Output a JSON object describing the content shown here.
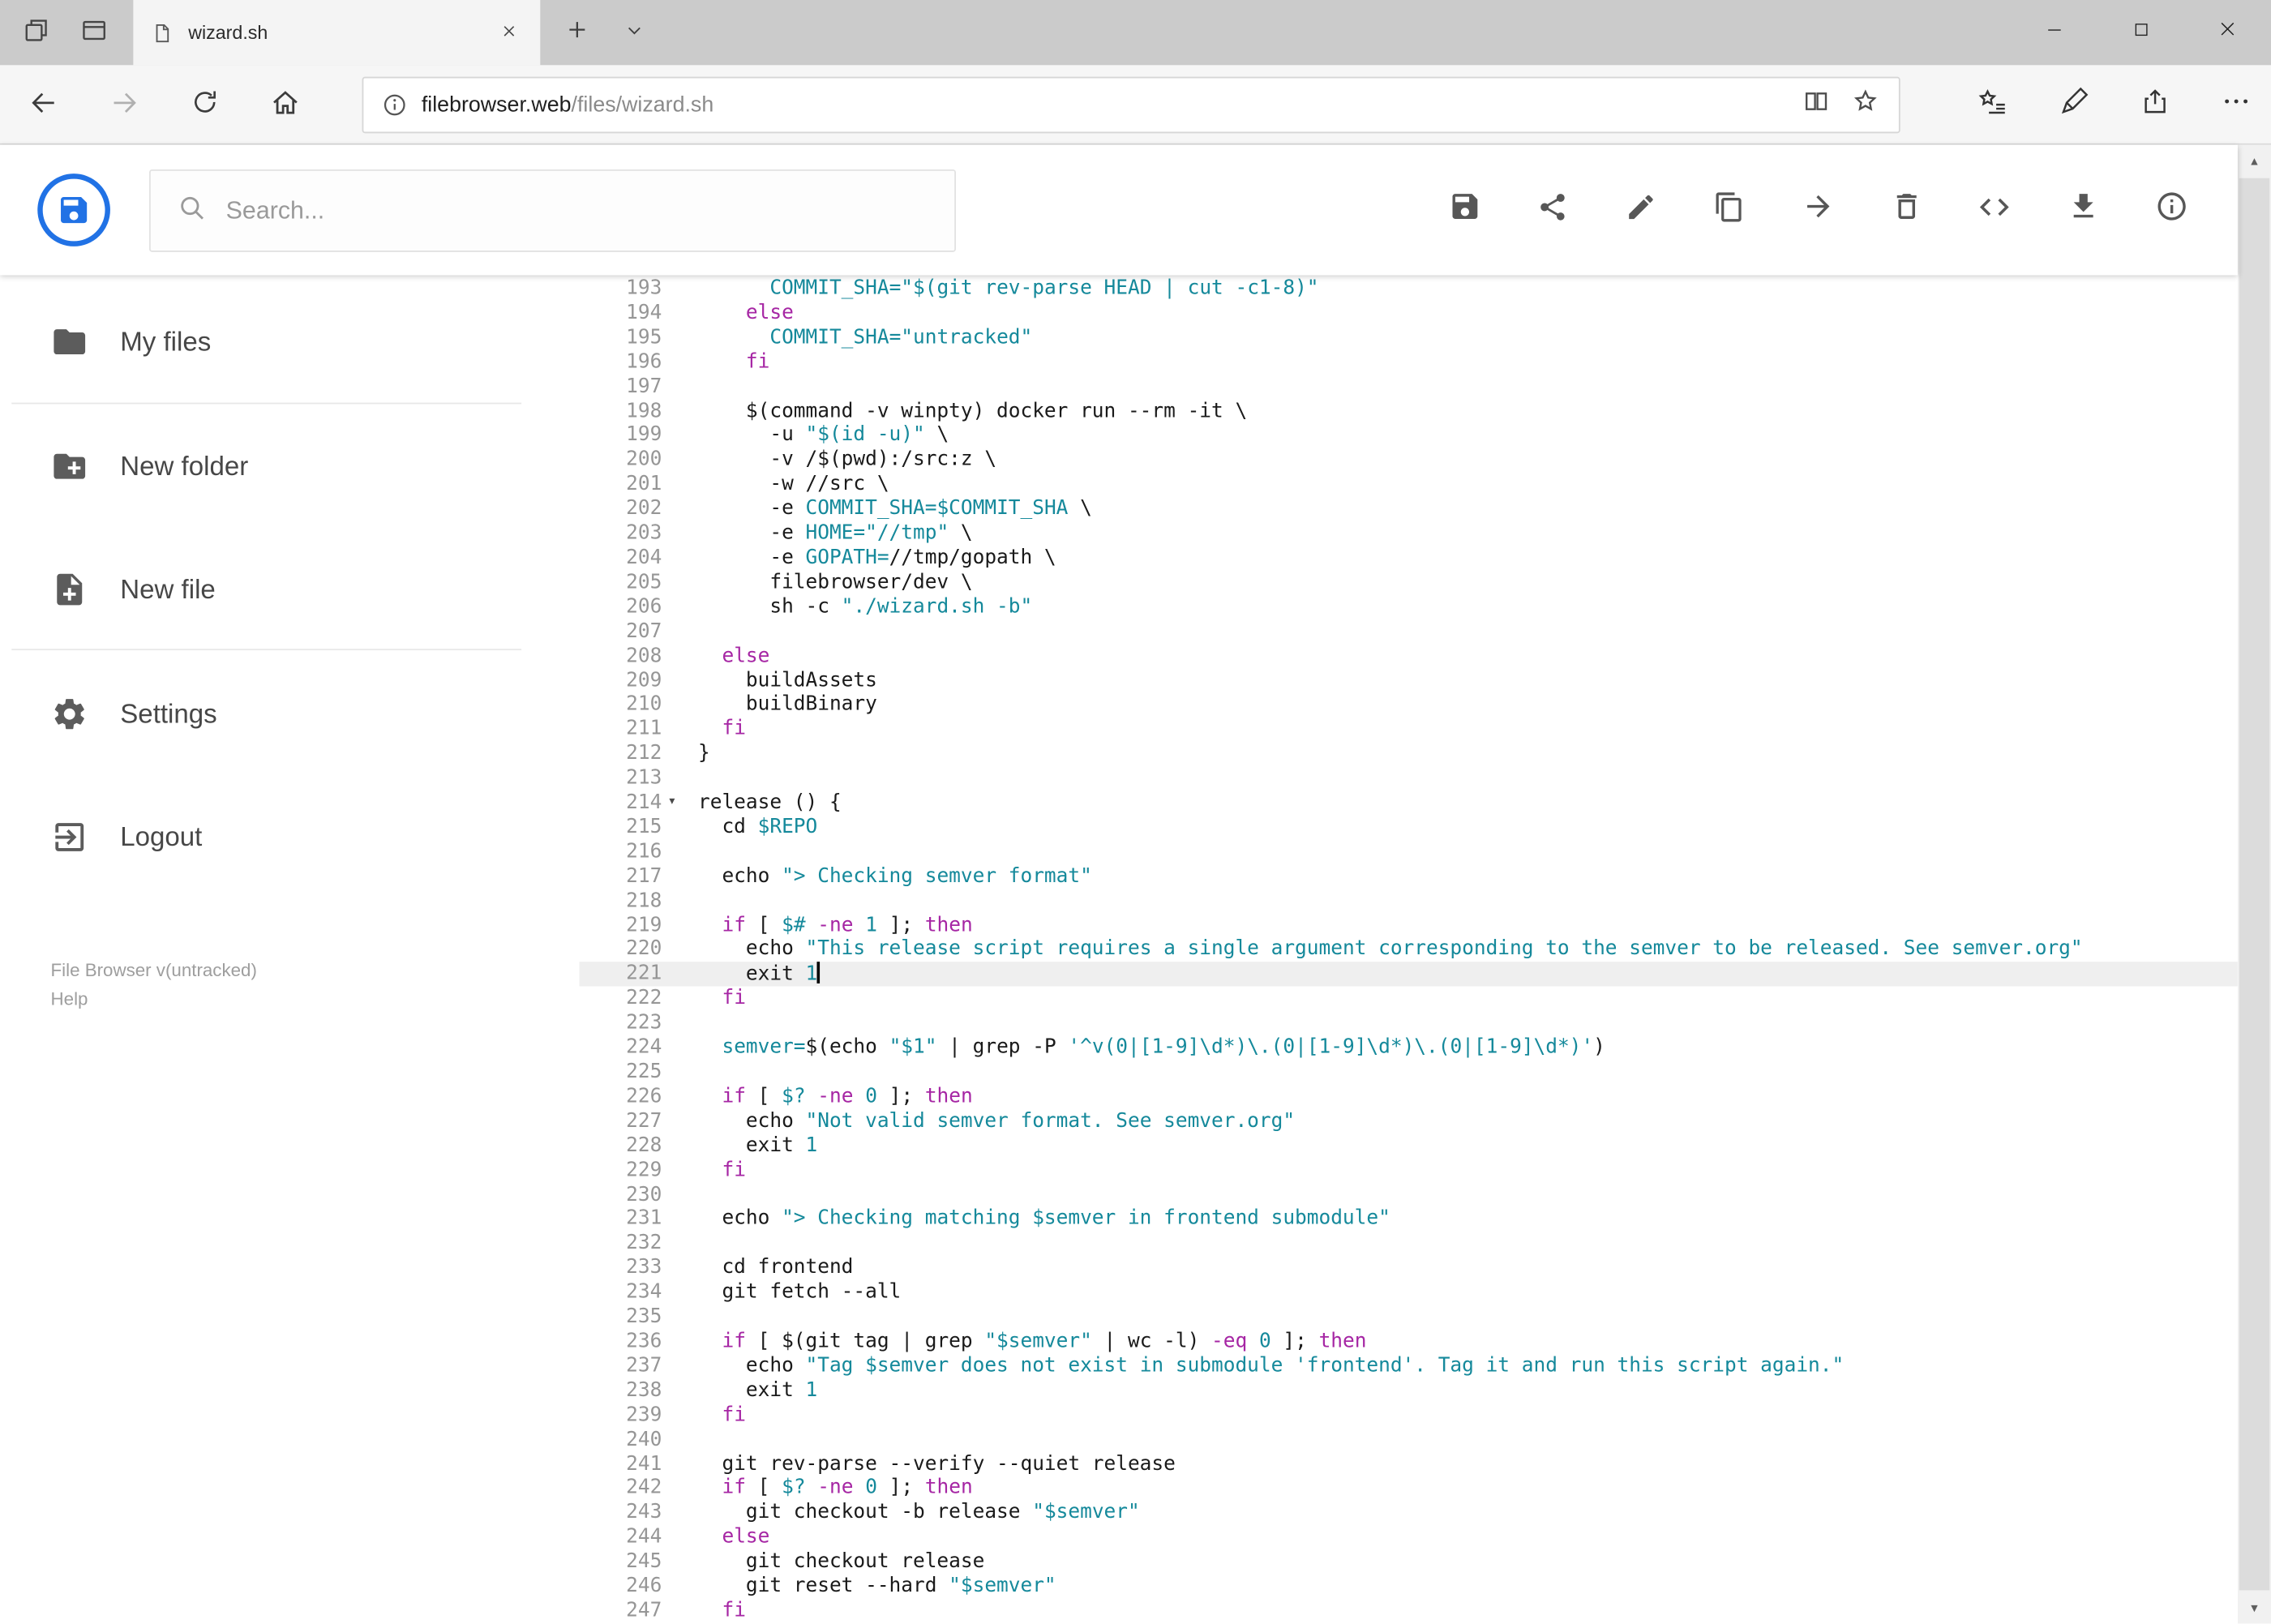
{
  "window": {
    "tab_title": "wizard.sh",
    "url": {
      "host": "filebrowser.web",
      "path": "/files/wizard.sh"
    }
  },
  "app": {
    "search_placeholder": "Search...",
    "toolbar_icons": [
      "save",
      "share",
      "edit",
      "copy",
      "move",
      "delete",
      "code",
      "download",
      "info"
    ],
    "sidebar": [
      {
        "label": "My files",
        "icon": "folder"
      },
      {
        "label": "New folder",
        "icon": "create-new-folder"
      },
      {
        "label": "New file",
        "icon": "new-file"
      },
      {
        "label": "Settings",
        "icon": "settings-gear"
      },
      {
        "label": "Logout",
        "icon": "logout"
      }
    ],
    "footer": {
      "version": "File Browser v(untracked)",
      "help": "Help"
    }
  },
  "editor": {
    "language": "shell",
    "first_line_number": 193,
    "active_line": 221,
    "fold_marker_line": 214,
    "lines": [
      "      COMMIT_SHA=\"$(git rev-parse HEAD | cut -c1-8)\"",
      "    else",
      "      COMMIT_SHA=\"untracked\"",
      "    fi",
      "",
      "    $(command -v winpty) docker run --rm -it \\",
      "      -u \"$(id -u)\" \\",
      "      -v /$(pwd):/src:z \\",
      "      -w //src \\",
      "      -e COMMIT_SHA=$COMMIT_SHA \\",
      "      -e HOME=\"//tmp\" \\",
      "      -e GOPATH=//tmp/gopath \\",
      "      filebrowser/dev \\",
      "      sh -c \"./wizard.sh -b\"",
      "",
      "  else",
      "    buildAssets",
      "    buildBinary",
      "  fi",
      "}",
      "",
      "release () {",
      "  cd $REPO",
      "",
      "  echo \"> Checking semver format\"",
      "",
      "  if [ $# -ne 1 ]; then",
      "    echo \"This release script requires a single argument corresponding to the semver to be released. See semver.org\"",
      "    exit 1",
      "  fi",
      "",
      "  semver=$(echo \"$1\" | grep -P '^v(0|[1-9]\\d*)\\.(0|[1-9]\\d*)\\.(0|[1-9]\\d*)')",
      "",
      "  if [ $? -ne 0 ]; then",
      "    echo \"Not valid semver format. See semver.org\"",
      "    exit 1",
      "  fi",
      "",
      "  echo \"> Checking matching $semver in frontend submodule\"",
      "",
      "  cd frontend",
      "  git fetch --all",
      "",
      "  if [ $(git tag | grep \"$semver\" | wc -l) -eq 0 ]; then",
      "    echo \"Tag $semver does not exist in submodule 'frontend'. Tag it and run this script again.\"",
      "    exit 1",
      "  fi",
      "",
      "  git rev-parse --verify --quiet release",
      "  if [ $? -ne 0 ]; then",
      "    git checkout -b release \"$semver\"",
      "  else",
      "    git checkout release",
      "    git reset --hard \"$semver\"",
      "  fi"
    ]
  },
  "colors": {
    "accent": "#2172e5",
    "active_line_background": "#efefef",
    "syntax": {
      "keyword": "#a626a4",
      "string": "#15899b",
      "variable": "#15899b",
      "number": "#15899b",
      "default": "#1a1a1a"
    }
  }
}
